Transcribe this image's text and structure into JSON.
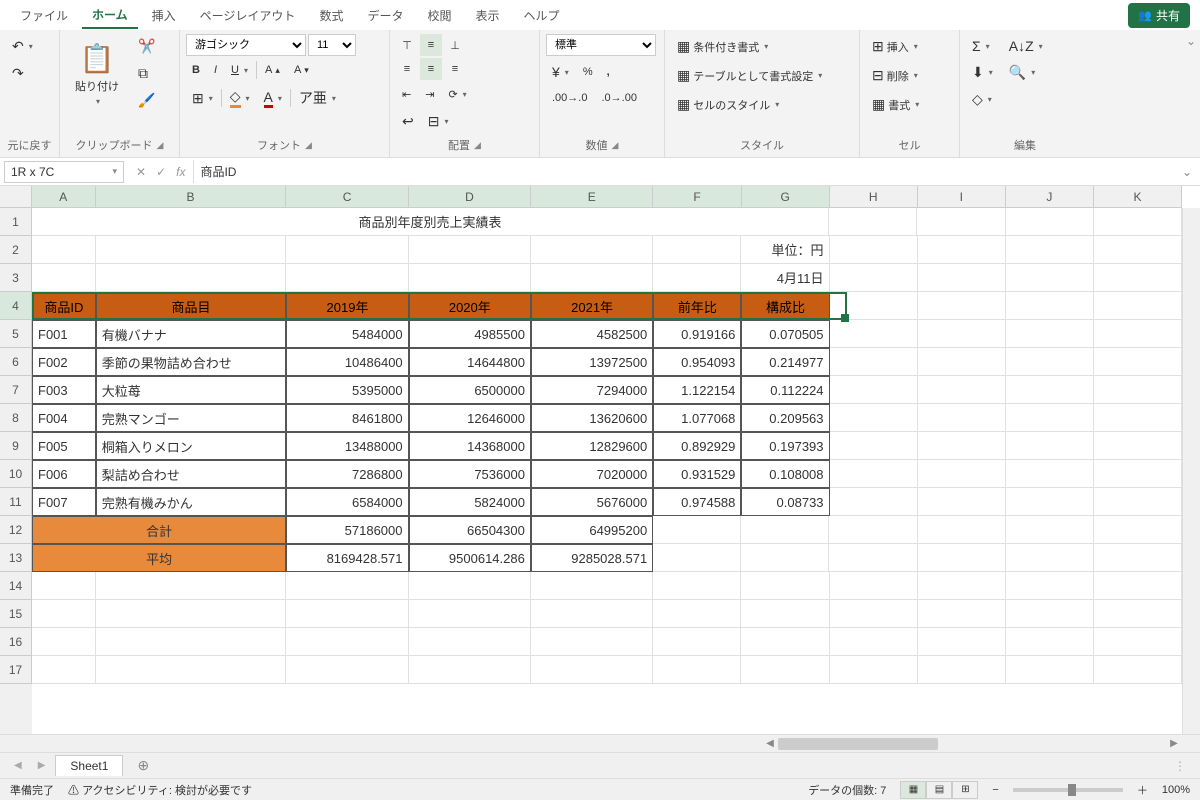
{
  "menu": {
    "items": [
      "ファイル",
      "ホーム",
      "挿入",
      "ページレイアウト",
      "数式",
      "データ",
      "校閲",
      "表示",
      "ヘルプ"
    ],
    "active": 1,
    "share": "共有"
  },
  "ribbon": {
    "undo": {
      "label": "元に戻す"
    },
    "clipboard": {
      "label": "クリップボード",
      "paste": "貼り付け"
    },
    "font": {
      "label": "フォント",
      "name": "游ゴシック",
      "size": "11"
    },
    "align": {
      "label": "配置"
    },
    "number": {
      "label": "数値",
      "format": "標準"
    },
    "styles": {
      "label": "スタイル",
      "cond": "条件付き書式",
      "table": "テーブルとして書式設定",
      "cell": "セルのスタイル"
    },
    "cells": {
      "label": "セル",
      "insert": "挿入",
      "delete": "削除",
      "format": "書式"
    },
    "editing": {
      "label": "編集"
    }
  },
  "formula_bar": {
    "name": "1R x 7C",
    "value": "商品ID"
  },
  "columns": [
    "A",
    "B",
    "C",
    "D",
    "E",
    "F",
    "G",
    "H",
    "I",
    "J",
    "K"
  ],
  "sheet": {
    "title": "商品別年度別売上実績表",
    "unit": "単位：円",
    "date": "4月11日",
    "headers": [
      "商品ID",
      "商品目",
      "2019年",
      "2020年",
      "2021年",
      "前年比",
      "構成比"
    ],
    "rows": [
      {
        "id": "F001",
        "name": "有機バナナ",
        "y19": "5484000",
        "y20": "4985500",
        "y21": "4582500",
        "prev": "0.919166",
        "comp": "0.070505"
      },
      {
        "id": "F002",
        "name": "季節の果物詰め合わせ",
        "y19": "10486400",
        "y20": "14644800",
        "y21": "13972500",
        "prev": "0.954093",
        "comp": "0.214977"
      },
      {
        "id": "F003",
        "name": "大粒苺",
        "y19": "5395000",
        "y20": "6500000",
        "y21": "7294000",
        "prev": "1.122154",
        "comp": "0.112224"
      },
      {
        "id": "F004",
        "name": "完熟マンゴー",
        "y19": "8461800",
        "y20": "12646000",
        "y21": "13620600",
        "prev": "1.077068",
        "comp": "0.209563"
      },
      {
        "id": "F005",
        "name": "桐箱入りメロン",
        "y19": "13488000",
        "y20": "14368000",
        "y21": "12829600",
        "prev": "0.892929",
        "comp": "0.197393"
      },
      {
        "id": "F006",
        "name": "梨詰め合わせ",
        "y19": "7286800",
        "y20": "7536000",
        "y21": "7020000",
        "prev": "0.931529",
        "comp": "0.108008"
      },
      {
        "id": "F007",
        "name": "完熟有機みかん",
        "y19": "6584000",
        "y20": "5824000",
        "y21": "5676000",
        "prev": "0.974588",
        "comp": "0.08733"
      }
    ],
    "total": {
      "label": "合計",
      "y19": "57186000",
      "y20": "66504300",
      "y21": "64995200"
    },
    "avg": {
      "label": "平均",
      "y19": "8169428.571",
      "y20": "9500614.286",
      "y21": "9285028.571"
    }
  },
  "tabs": {
    "sheet1": "Sheet1"
  },
  "status": {
    "ready": "準備完了",
    "access": "アクセシビリティ: 検討が必要です",
    "count": "データの個数: 7",
    "zoom": "100%"
  }
}
